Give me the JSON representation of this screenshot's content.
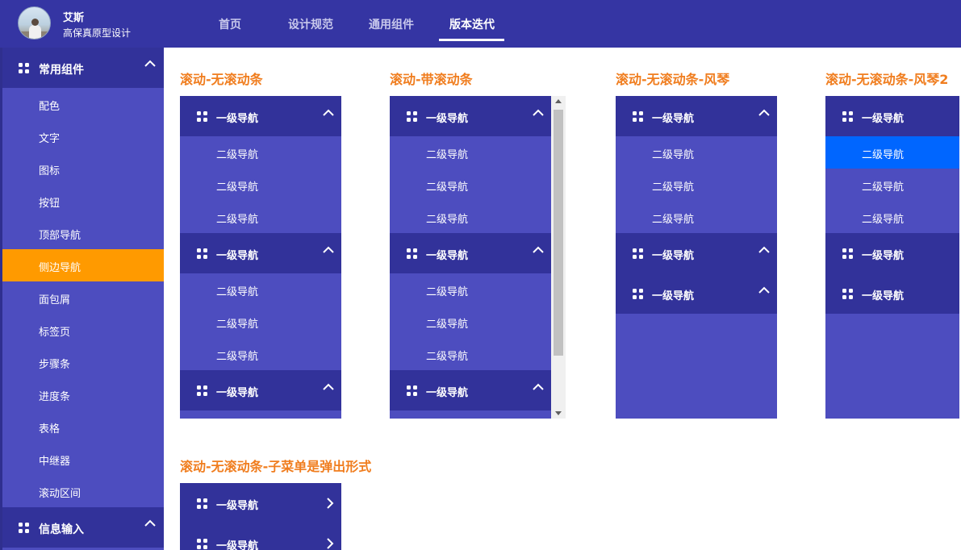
{
  "header": {
    "user_name": "艾斯",
    "user_subtitle": "高保真原型设计",
    "tabs": [
      {
        "label": "首页",
        "active": false
      },
      {
        "label": "设计规范",
        "active": false
      },
      {
        "label": "通用组件",
        "active": false
      },
      {
        "label": "版本迭代",
        "active": true
      }
    ]
  },
  "sidebar": {
    "group1": {
      "label": "常用组件",
      "icon": "grid-icon",
      "expanded": true
    },
    "items": [
      {
        "label": "配色"
      },
      {
        "label": "文字"
      },
      {
        "label": "图标"
      },
      {
        "label": "按钮"
      },
      {
        "label": "顶部导航"
      },
      {
        "label": "侧边导航",
        "active": true
      },
      {
        "label": "面包屑"
      },
      {
        "label": "标签页"
      },
      {
        "label": "步骤条"
      },
      {
        "label": "进度条"
      },
      {
        "label": "表格"
      },
      {
        "label": "中继器"
      },
      {
        "label": "滚动区间"
      }
    ],
    "group2": {
      "label": "信息输入",
      "icon": "grid-icon",
      "expanded": true
    }
  },
  "demos": {
    "d1": {
      "title": "滚动-无滚动条"
    },
    "d2": {
      "title": "滚动-带滚动条"
    },
    "d3": {
      "title": "滚动-无滚动条-风琴"
    },
    "d4": {
      "title": "滚动-无滚动条-风琴2"
    },
    "d5": {
      "title": "滚动-无滚动条-子菜单是弹出形式"
    }
  },
  "nav": {
    "level1_label": "一级导航",
    "level2_label": "二级导航"
  },
  "colors": {
    "header_bg": "#3535a3",
    "level1_bg": "#32329a",
    "level2_bg": "#4d4dbf",
    "active_side_item": "#ff9a00",
    "active_level2": "#0066ff",
    "title_orange": "#f07d1e"
  }
}
